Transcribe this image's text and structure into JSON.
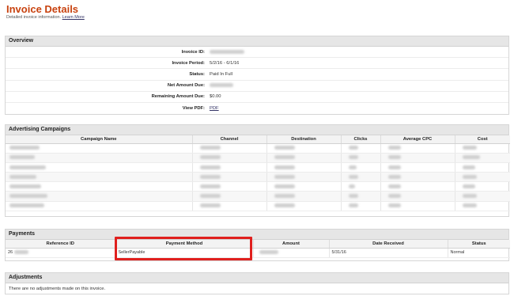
{
  "header": {
    "title": "Invoice Details",
    "subtitle": "Detailed invoice information.",
    "learn_more": "Learn More"
  },
  "overview": {
    "title": "Overview",
    "rows": [
      {
        "label": "Invoice ID:",
        "value": ""
      },
      {
        "label": "Invoice Period:",
        "value": "5/2/16 - 6/1/16"
      },
      {
        "label": "Status:",
        "value": "Paid In Full"
      },
      {
        "label": "Net Amount Due:",
        "value": ""
      },
      {
        "label": "Remaining Amount Due:",
        "value": "$0.00"
      },
      {
        "label": "View PDF:",
        "value": "PDF"
      }
    ]
  },
  "campaigns": {
    "title": "Advertising Campaigns",
    "columns": [
      "Campaign Name",
      "Channel",
      "Destination",
      "Clicks",
      "Average CPC",
      "Cost"
    ],
    "row_count": 7
  },
  "payments": {
    "title": "Payments",
    "columns": [
      "Reference ID",
      "Payment Method",
      "Amount",
      "Date Received",
      "Status"
    ],
    "row": {
      "reference_id": "26",
      "payment_method": "SellerPayable",
      "amount": "",
      "date_received": "5/31/16",
      "status": "Normal"
    }
  },
  "adjustments": {
    "title": "Adjustments",
    "message": "There are no adjustments made on this invoice."
  },
  "colors": {
    "title_accent": "#c8420f",
    "highlight": "#e0201e",
    "panel_header": "#e6e6e6"
  }
}
